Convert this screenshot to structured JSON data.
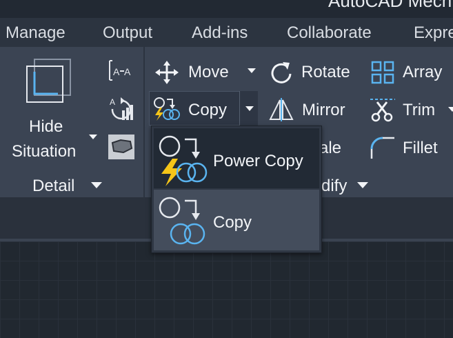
{
  "app": {
    "title": "AutoCAD Mech"
  },
  "menu_tabs": [
    "Manage",
    "Output",
    "Add-ins",
    "Collaborate",
    "Expre"
  ],
  "detail_panel": {
    "hide_situation_line1": "Hide",
    "hide_situation_line2": "Situation",
    "panel_label": "Detail"
  },
  "modify_panel": {
    "move": "Move",
    "rotate": "Rotate",
    "array": "Array",
    "copy": "Copy",
    "mirror": "Mirror",
    "trim": "Trim",
    "scale_partial": "ale",
    "fillet": "Fillet",
    "panel_label_partial": "dify"
  },
  "copy_dropdown": {
    "items": [
      {
        "label": "Power Copy"
      },
      {
        "label": "Copy"
      }
    ]
  },
  "colors": {
    "accent": "#5ab4f0",
    "lightning": "#f5c518",
    "ribbon_bg": "#3b4453",
    "menubar_bg": "#2c3440"
  }
}
